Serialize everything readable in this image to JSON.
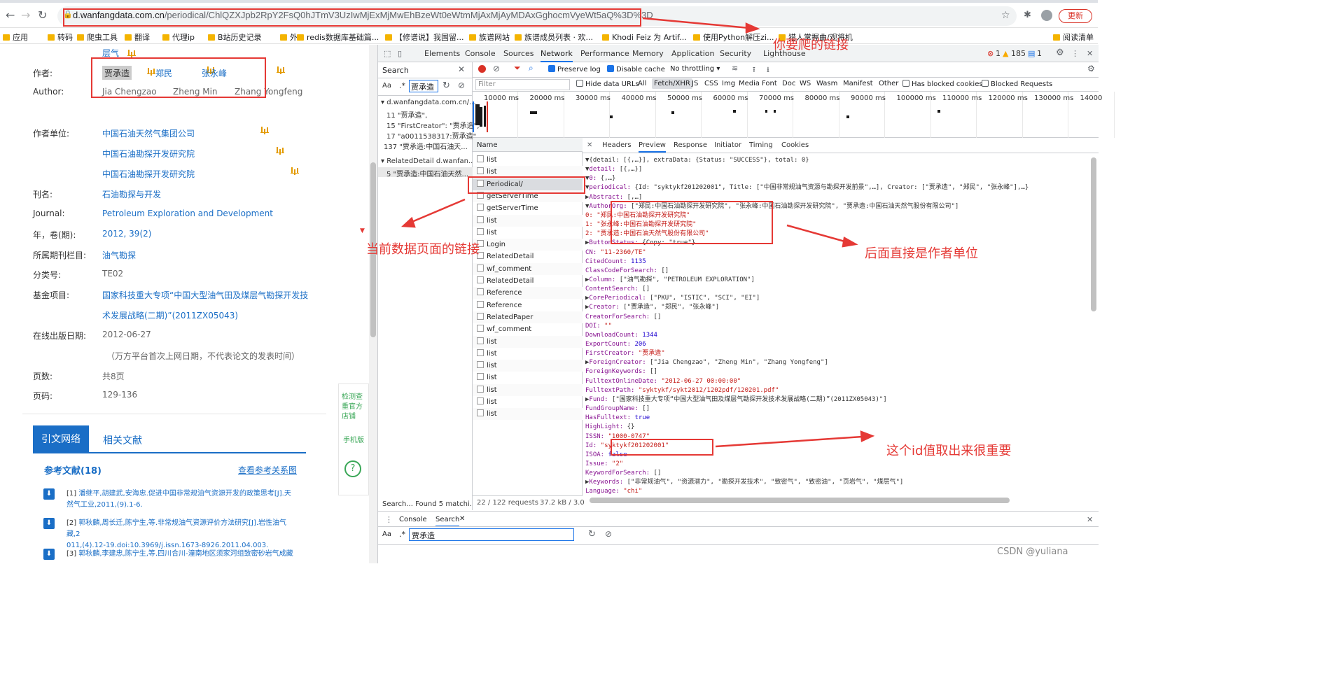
{
  "browser": {
    "url_host": "d.wanfangdata.com.cn",
    "url_path": "/periodical/ChlQZXJpb2RpY2FsQ0hJTmV3UzIwMjExMjMwEhBzeWt0eWtmMjAxMjAyMDAxGghocmVyeWt5aQ%3D%3D",
    "update_label": "更新",
    "bookmarks": [
      "应用",
      "转码",
      "爬虫工具",
      "翻译",
      "代理ip",
      "B站历史记录",
      "外",
      "redis数据库基础篇...",
      "【修谱说】我国留...",
      "族谱网站",
      "族谱成员列表 · 欢...",
      "Khodi Feiz 为 Artif...",
      "使用Python解压zi...",
      "猎人掌握曲/观将机",
      "阅读清单"
    ]
  },
  "page": {
    "top_label": "层气",
    "rows": [
      {
        "label": "作者:",
        "values": [
          "贾承造",
          "郑民",
          "张永峰"
        ]
      },
      {
        "label": "Author:",
        "values": [
          "Jia Chengzao",
          "Zheng Min",
          "Zhang Yongfeng"
        ]
      },
      {
        "label": "作者单位:",
        "values": [
          "中国石油天然气集团公司",
          "中国石油勘探开发研究院",
          "中国石油勘探开发研究院"
        ]
      },
      {
        "label": "刊名:",
        "value": "石油勘探与开发"
      },
      {
        "label": "Journal:",
        "value": "Petroleum Exploration and Development"
      },
      {
        "label": "年，卷(期):",
        "value": "2012, 39(2)"
      },
      {
        "label": "所属期刊栏目:",
        "value": "油气勘探"
      },
      {
        "label": "分类号:",
        "value": "TE02"
      },
      {
        "label": "基金项目:",
        "value": "国家科技重大专项“中国大型油气田及煤层气勘探开发技术发展战略(二期)”(2011ZX05043)"
      },
      {
        "label": "在线出版日期:",
        "value": "2012-06-27",
        "note": "（万方平台首次上网日期，不代表论文的发表时间）"
      },
      {
        "label": "页数:",
        "value": "共8页"
      },
      {
        "label": "页码:",
        "value": "129-136"
      }
    ],
    "fund_line1": "国家科技重大专项“中国大型油气田及煤层气勘探开发技",
    "fund_line2": "术发展战略(二期)”(2011ZX05043)",
    "tabs": [
      "引文网络",
      "相关文献"
    ],
    "refs_title": "参考文献(18)",
    "refs_link": "查看参考关系图",
    "refs": [
      {
        "num": "[1]",
        "line1": "潘继平,胡建武,安海忠.促进中国非常规油气资源开发的政策思考[J].天",
        "line2": "然气工业,2011,(9).1-6."
      },
      {
        "num": "[2]",
        "line1": "郭秋麟,周长迁,陈宁生,等.非常规油气资源评价方法研究[J].岩性油气藏,2",
        "line2": "011,(4).12-19.doi:10.3969/j.issn.1673-8926.2011.04.003."
      },
      {
        "num": "[3]",
        "line1": "郭秋麟,李建忠,陈宁生,等.四川合川-潼南地区须家河组致密砂岩气成藏",
        "line2": ""
      }
    ],
    "side_widgets": [
      "检测查重官方店铺",
      "手机版",
      "?"
    ]
  },
  "devtools": {
    "tabs": [
      "Elements",
      "Console",
      "Sources",
      "Network",
      "Performance",
      "Memory",
      "Application",
      "Security",
      "Lighthouse"
    ],
    "errors": "1",
    "warnings": "185",
    "messages": "1",
    "search_title": "Search",
    "search_query": "贾承造",
    "search_results": [
      {
        "file": "d.wanfangdata.com.cn/...",
        "lines": [
          "11  \"贾承造\",",
          "15  \"FirstCreator\": \"贾承造\",",
          "17  \"a0011538317:贾承造\",",
          "137  \"贾承造:中国石油天..."
        ]
      },
      {
        "file": "RelatedDetail   d.wanfan...",
        "lines": [
          "5  \"贾承造:中国石油天然..."
        ]
      }
    ],
    "search_status": "Search...   Found 5 matchi...",
    "toolbar": {
      "preserve_log": "Preserve log",
      "disable_cache": "Disable cache",
      "throttling": "No throttling"
    },
    "filter": {
      "placeholder": "Filter",
      "hide_data_urls": "Hide data URLs",
      "types": [
        "All",
        "Fetch/XHR",
        "JS",
        "CSS",
        "Img",
        "Media",
        "Font",
        "Doc",
        "WS",
        "Wasm",
        "Manifest",
        "Other"
      ],
      "blocked_cookies": "Has blocked cookies",
      "blocked_requests": "Blocked Requests"
    },
    "timeline_ticks": [
      "10000 ms",
      "20000 ms",
      "30000 ms",
      "40000 ms",
      "50000 ms",
      "60000 ms",
      "70000 ms",
      "80000 ms",
      "90000 ms",
      "100000 ms",
      "110000 ms",
      "120000 ms",
      "130000 ms",
      "14000"
    ],
    "name_header": "Name",
    "requests": [
      "list",
      "list",
      "Periodical/",
      "getServerTime",
      "getServerTime",
      "list",
      "list",
      "Login",
      "RelatedDetail",
      "wf_comment",
      "RelatedDetail",
      "Reference",
      "Reference",
      "RelatedPaper",
      "wf_comment",
      "list",
      "list",
      "list",
      "list",
      "list",
      "list",
      "list"
    ],
    "status": "22 / 122 requests",
    "transfer": "37.2 kB / 3.0",
    "preview_tabs": [
      "Headers",
      "Preview",
      "Response",
      "Initiator",
      "Timing",
      "Cookies"
    ],
    "json_lines": [
      "▼{detail: [{,…}], extraData: {Status: \"SUCCESS\"}, total: 0}",
      "  ▼detail: [{,…}]",
      "    ▼0: {,…}",
      "      ▼periodical: {Id: \"syktykf201202001\", Title: [\"中国非常规油气资源与勘探开发前景\",…], Creator: [\"贾承造\", \"郑民\", \"张永峰\"],…}",
      "        ▶Abstract: [,…]",
      "        ▼AuthorOrg: [\"郑民:中国石油勘探开发研究院\", \"张永峰:中国石油勘探开发研究院\", \"贾承造:中国石油天然气股份有限公司\"]",
      "            0: \"郑民:中国石油勘探开发研究院\"",
      "            1: \"张永峰:中国石油勘探开发研究院\"",
      "            2: \"贾承造:中国石油天然气股份有限公司\"",
      "        ▶ButtonStatus: {Copy: \"true\"}",
      "          CN: \"11-2360/TE\"",
      "          CitedCount: 1135",
      "          ClassCodeForSearch: []",
      "        ▶Column: [\"油气勘探\", \"PETROLEUM EXPLORATION\"]",
      "          ContentSearch: []",
      "        ▶CorePeriodical: [\"PKU\", \"ISTIC\", \"SCI\", \"EI\"]",
      "        ▶Creator: [\"贾承造\", \"郑民\", \"张永峰\"]",
      "          CreatorForSearch: []",
      "          DOI: \"\"",
      "          DownloadCount: 1344",
      "          ExportCount: 206",
      "          FirstCreator: \"贾承造\"",
      "        ▶ForeignCreator: [\"Jia Chengzao\", \"Zheng Min\", \"Zhang Yongfeng\"]",
      "          ForeignKeywords: []",
      "          FulltextOnlineDate: \"2012-06-27 00:00:00\"",
      "          FulltextPath: \"syktykf/sykt2012/1202pdf/120201.pdf\"",
      "        ▶Fund: [\"国家科技重大专项“中国大型油气田及煤层气勘探开发技术发展战略(二期)”(2011ZX05043)\"]",
      "          FundGroupName: []",
      "          HasFulltext: true",
      "          HighLight: {}",
      "          ISSN: \"1000-0747\"",
      "          Id: \"syktykf201202001\"",
      "          ISOA: false",
      "          Issue: \"2\"",
      "          KeywordForSearch: []",
      "        ▶Keywords: [\"非常规油气\", \"资源潜力\", \"勘探开发技术\", \"致密气\", \"致密油\", \"页岩气\", \"煤层气\"]",
      "          Language: \"chi\""
    ],
    "drawer_tabs": [
      "Console",
      "Search"
    ],
    "drawer_query": "贾承造"
  },
  "annotations": {
    "crawl_link": "你要爬的链接",
    "current_link": "当前数据页面的链接",
    "author_org": "后面直接是作者单位",
    "id_note": "这个id值取出来很重要",
    "color": "#e53935"
  },
  "watermark": "CSDN @yuliana"
}
